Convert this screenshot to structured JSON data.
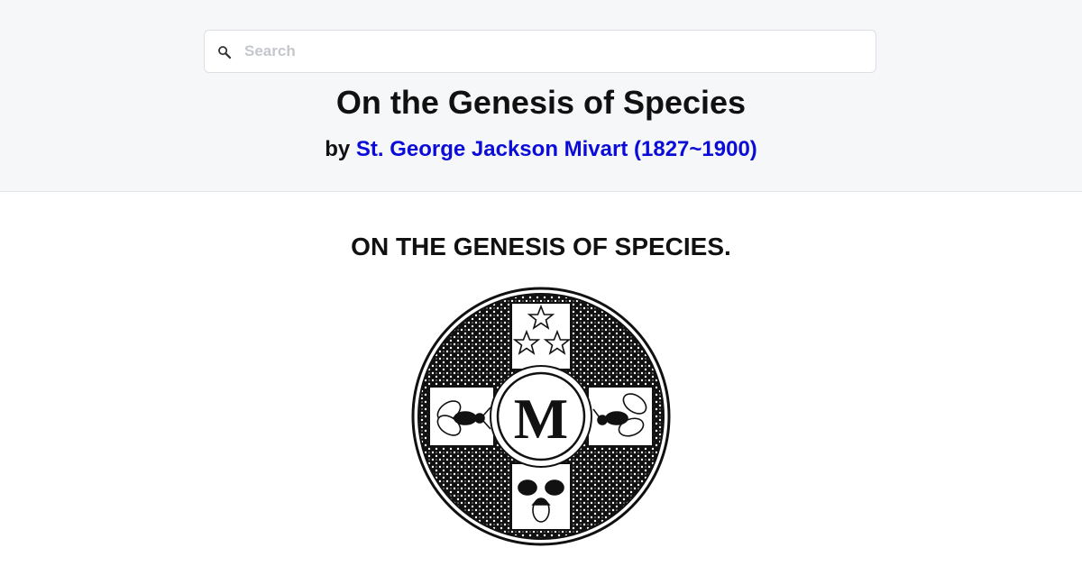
{
  "search": {
    "placeholder": "Search",
    "icon": "search-icon"
  },
  "book": {
    "title": "On the Genesis of Species",
    "by_prefix": "by",
    "author": "St. George Jackson Mivart (1827~1900)"
  },
  "content": {
    "heading": "ON THE GENESIS OF SPECIES.",
    "emblem_monogram": "M"
  },
  "colors": {
    "link": "#0c0cd8",
    "header_bg": "#f6f7f9"
  }
}
